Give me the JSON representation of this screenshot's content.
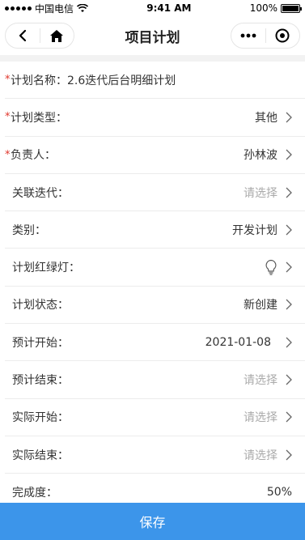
{
  "status_bar": {
    "carrier": "中国电信",
    "time": "9:41 AM",
    "battery": "100%",
    "battery_level": 1.0
  },
  "nav": {
    "title": "项目计划",
    "back_icon": "chevron-left-icon",
    "home_icon": "home-icon",
    "more_icon": "more-dots-icon",
    "close_icon": "target-icon"
  },
  "form": {
    "plan_name": {
      "label": "计划名称：",
      "value": "2.6迭代后台明细计划",
      "required": true
    },
    "plan_type": {
      "label": "计划类型：",
      "value": "其他",
      "required": true
    },
    "owner": {
      "label": "负责人：",
      "value": "孙林波",
      "required": true
    },
    "iteration": {
      "label": "关联迭代：",
      "value": "请选择",
      "placeholder": true
    },
    "category": {
      "label": "类别：",
      "value": "开发计划"
    },
    "traffic_light": {
      "label": "计划红绿灯：",
      "icon": "lightbulb-icon"
    },
    "status": {
      "label": "计划状态：",
      "value": "新创建"
    },
    "plan_start": {
      "label": "预计开始：",
      "value": "2021-01-08"
    },
    "plan_end": {
      "label": "预计结束：",
      "value": "请选择",
      "placeholder": true
    },
    "actual_start": {
      "label": "实际开始：",
      "value": "请选择",
      "placeholder": true
    },
    "actual_end": {
      "label": "实际结束：",
      "value": "请选择",
      "placeholder": true
    },
    "progress": {
      "label": "完成度：",
      "value": "50%"
    }
  },
  "required_mark": "*",
  "save_label": "保存",
  "colors": {
    "accent": "#3c95ea",
    "required": "#e0352b",
    "placeholder": "#aaaaaa"
  }
}
